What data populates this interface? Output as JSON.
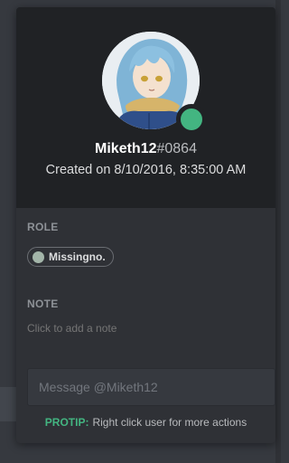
{
  "profile": {
    "username": "Miketh12",
    "discriminator": "#0864",
    "created": "Created on 8/10/2016, 8:35:00 AM",
    "status": "online",
    "status_color": "#43b581"
  },
  "roles": {
    "label": "ROLE",
    "items": [
      {
        "name": "Missingno.",
        "color": "#a3b5a9"
      }
    ]
  },
  "note": {
    "label": "NOTE",
    "placeholder": "Click to add a note"
  },
  "message": {
    "placeholder": "Message @Miketh12"
  },
  "protip": {
    "label": "PROTIP:",
    "text": "Right click user for more actions"
  },
  "colors": {
    "header_bg": "#202225",
    "body_bg": "#2f3136",
    "accent_green": "#43b581"
  }
}
